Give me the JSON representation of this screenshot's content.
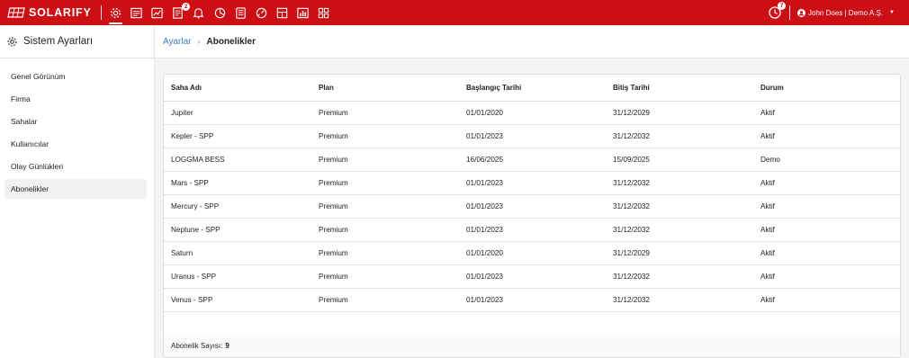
{
  "brand": {
    "name": "SOLARIFY",
    "accent": "#cc0e15"
  },
  "topnav": {
    "icons": [
      {
        "name": "gear-icon",
        "active": true
      },
      {
        "name": "dashboard-icon"
      },
      {
        "name": "chart-icon"
      },
      {
        "name": "report-icon",
        "badge": "2"
      },
      {
        "name": "bell-icon"
      },
      {
        "name": "pie-chart-icon"
      },
      {
        "name": "list-icon"
      },
      {
        "name": "gauge-icon"
      },
      {
        "name": "grid-icon"
      },
      {
        "name": "bar-chart-icon"
      },
      {
        "name": "apps-icon"
      }
    ],
    "notification_badge": "7",
    "user_label": "John Does | Demo A.Ş."
  },
  "sidebar": {
    "title": "Sistem Ayarları",
    "items": [
      {
        "label": "Genel Görünüm"
      },
      {
        "label": "Firma"
      },
      {
        "label": "Sahalar"
      },
      {
        "label": "Kullanıcılar"
      },
      {
        "label": "Olay Günlükleri"
      },
      {
        "label": "Abonelikler",
        "active": true
      }
    ]
  },
  "breadcrumb": {
    "parent": "Ayarlar",
    "current": "Abonelikler"
  },
  "table": {
    "columns": [
      "Saha Adı",
      "Plan",
      "Başlangıç Tarihi",
      "Bitiş Tarihi",
      "Durum"
    ],
    "rows": [
      [
        "Jupiter",
        "Premium",
        "01/01/2020",
        "31/12/2029",
        "Aktif"
      ],
      [
        "Kepler - SPP",
        "Premium",
        "01/01/2023",
        "31/12/2032",
        "Aktif"
      ],
      [
        "LOGGMA BESS",
        "Premium",
        "16/06/2025",
        "15/09/2025",
        "Demo"
      ],
      [
        "Mars - SPP",
        "Premium",
        "01/01/2023",
        "31/12/2032",
        "Aktif"
      ],
      [
        "Mercury - SPP",
        "Premium",
        "01/01/2023",
        "31/12/2032",
        "Aktif"
      ],
      [
        "Neptune - SPP",
        "Premium",
        "01/01/2023",
        "31/12/2032",
        "Aktif"
      ],
      [
        "Saturn",
        "Premium",
        "01/01/2020",
        "31/12/2029",
        "Aktif"
      ],
      [
        "Uranus - SPP",
        "Premium",
        "01/01/2023",
        "31/12/2032",
        "Aktif"
      ],
      [
        "Venus - SPP",
        "Premium",
        "01/01/2023",
        "31/12/2032",
        "Aktif"
      ]
    ],
    "footer_label": "Abonelik Sayısı:",
    "footer_count": "9"
  }
}
